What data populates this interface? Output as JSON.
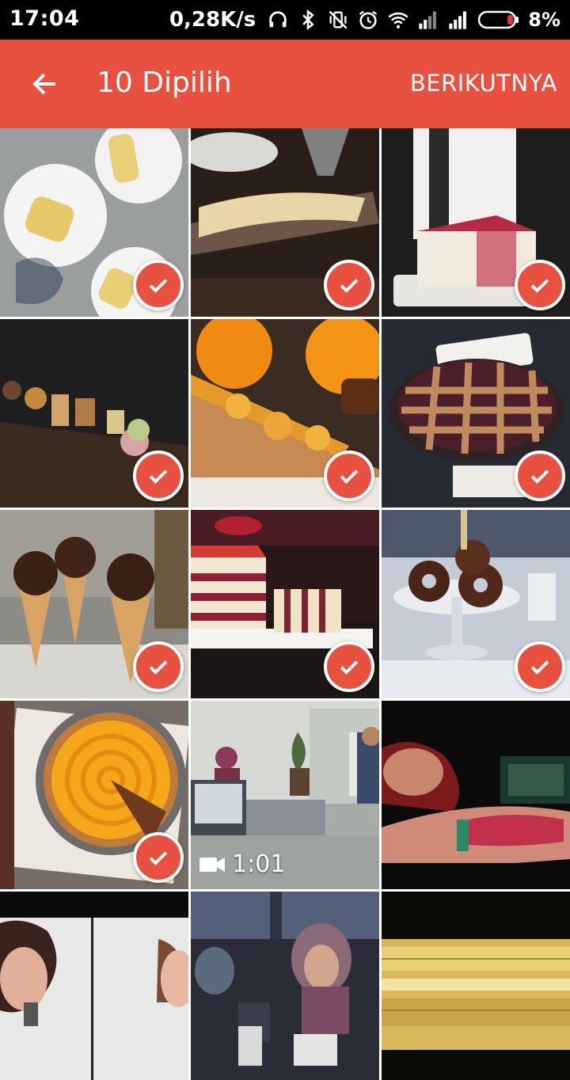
{
  "status_bar": {
    "time": "17:04",
    "net_speed": "0,28K/s",
    "battery_percent": "8%",
    "icons": [
      "headset-icon",
      "bluetooth-icon",
      "vibrate-off-icon",
      "alarm-icon",
      "wifi-icon",
      "signal-icon",
      "signal-icon-2",
      "battery-icon"
    ]
  },
  "app_bar": {
    "title": "10 Dipilih",
    "next_label": "BERIKUTNYA",
    "back_icon": "arrow-back-icon",
    "background_color": "#e85040"
  },
  "grid": {
    "selected_color": "#e85040",
    "tiles": [
      {
        "selected": true,
        "type": "photo",
        "subject": "popsicles"
      },
      {
        "selected": true,
        "type": "photo",
        "subject": "cookies"
      },
      {
        "selected": true,
        "type": "photo",
        "subject": "ice cream cake"
      },
      {
        "selected": true,
        "type": "photo",
        "subject": "pastry assortment"
      },
      {
        "selected": true,
        "type": "photo",
        "subject": "orange tart"
      },
      {
        "selected": true,
        "type": "photo",
        "subject": "lattice pie"
      },
      {
        "selected": true,
        "type": "photo",
        "subject": "chocolate ice cream cones"
      },
      {
        "selected": true,
        "type": "photo",
        "subject": "layered cake"
      },
      {
        "selected": true,
        "type": "photo",
        "subject": "chocolate doughnuts"
      },
      {
        "selected": true,
        "type": "photo",
        "subject": "mango tart"
      },
      {
        "selected": false,
        "type": "video",
        "subject": "office",
        "duration": "1:01"
      },
      {
        "selected": false,
        "type": "photo",
        "subject": "tattooed arm"
      },
      {
        "selected": false,
        "type": "photo",
        "subject": "two faces"
      },
      {
        "selected": false,
        "type": "photo",
        "subject": "cafe people"
      },
      {
        "selected": false,
        "type": "photo",
        "subject": "wafer snack"
      }
    ]
  }
}
